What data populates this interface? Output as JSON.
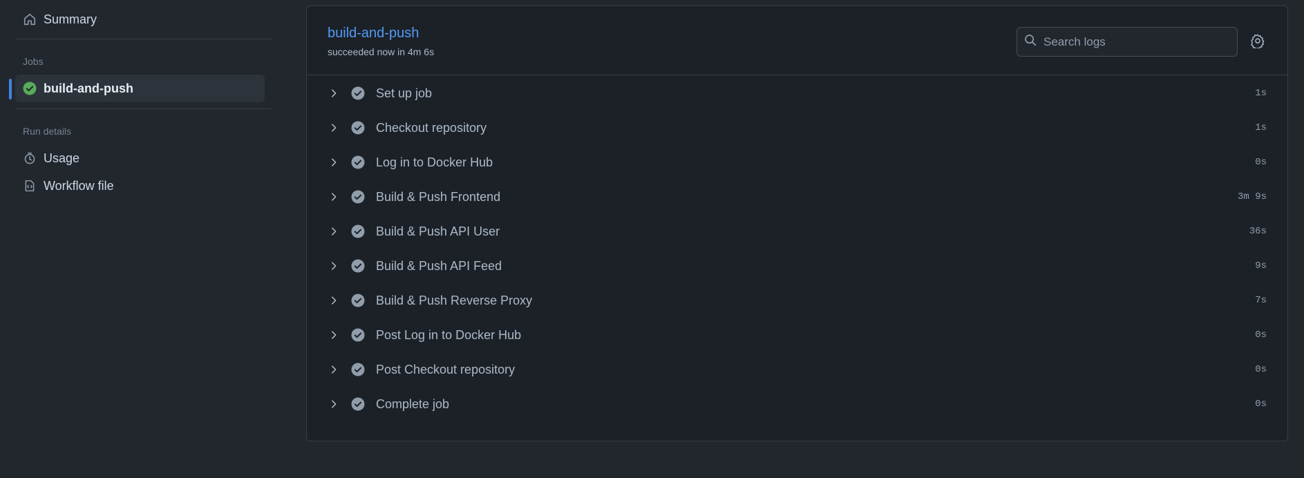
{
  "sidebar": {
    "summary_label": "Summary",
    "jobs_heading": "Jobs",
    "jobs": [
      {
        "label": "build-and-push",
        "status": "success",
        "active": true
      }
    ],
    "run_details_heading": "Run details",
    "run_details": [
      {
        "label": "Usage",
        "icon": "stopwatch-icon"
      },
      {
        "label": "Workflow file",
        "icon": "file-code-icon"
      }
    ]
  },
  "job": {
    "title": "build-and-push",
    "subtitle": "succeeded now in 4m 6s"
  },
  "search": {
    "placeholder": "Search logs",
    "value": ""
  },
  "steps": [
    {
      "name": "Set up job",
      "duration": "1s"
    },
    {
      "name": "Checkout repository",
      "duration": "1s"
    },
    {
      "name": "Log in to Docker Hub",
      "duration": "0s"
    },
    {
      "name": "Build & Push Frontend",
      "duration": "3m 9s"
    },
    {
      "name": "Build & Push API User",
      "duration": "36s"
    },
    {
      "name": "Build & Push API Feed",
      "duration": "9s"
    },
    {
      "name": "Build & Push Reverse Proxy",
      "duration": "7s"
    },
    {
      "name": "Post Log in to Docker Hub",
      "duration": "0s"
    },
    {
      "name": "Post Checkout repository",
      "duration": "0s"
    },
    {
      "name": "Complete job",
      "duration": "0s"
    }
  ],
  "colors": {
    "background": "#22272e",
    "panel": "#1c2128",
    "accent": "#539bf5",
    "success": "#57ab5a",
    "active_indicator": "#4184e4"
  }
}
